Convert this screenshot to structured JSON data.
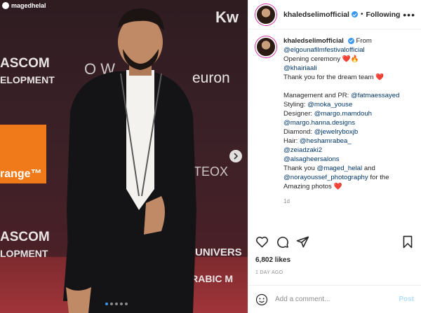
{
  "watermark": {
    "text": "magedhelal"
  },
  "sponsors": {
    "kw": "Kw",
    "ascom_top": "ASCOM",
    "dev_top": "ELOPMENT",
    "ow": "O W",
    "euron": "euron",
    "orange": "range™",
    "teox": "TEOX",
    "ascom_bottom": "ASCOM",
    "dev_bottom": "LOPMENT",
    "universal": "UNIVERS",
    "arabic": "ARABIC M"
  },
  "carousel": {
    "count": 5,
    "active_index": 1
  },
  "header": {
    "username": "khaledselimofficial",
    "separator": "•",
    "follow_label": "Following",
    "more_label": "•••"
  },
  "caption": {
    "username": "khaledselimofficial",
    "lines": [
      {
        "text": "From"
      },
      {
        "link": "@elgounafilmfestivalofficial"
      },
      {
        "text": "Opening ceremony ❤️🔥"
      },
      {
        "link": "@khairiaali"
      },
      {
        "text": "Thank you for the dream team ❤️"
      },
      {
        "gap": true
      },
      {
        "text": "Management and PR: ",
        "link": "@fatmaessayed"
      },
      {
        "text": "Styling: ",
        "link": "@moka_youse"
      },
      {
        "text": "Designer: ",
        "link": "@margo.mamdouh"
      },
      {
        "link": "@margo.hanna.designs"
      },
      {
        "text": "Diamond: ",
        "link": "@jewelryboxjb"
      },
      {
        "text": "Hair: ",
        "link": "@heshamrabea_"
      },
      {
        "link": "@zeiadzaki2"
      },
      {
        "link": "@alsagheersalons"
      },
      {
        "text": "Thank you ",
        "link": "@maged_helal",
        "after": " and"
      },
      {
        "link": "@norayoussef_photography",
        "after": " for the"
      },
      {
        "text": "Amazing photos ❤️"
      }
    ],
    "timestamp": "1d"
  },
  "likes": "6,802 likes",
  "date": "1 DAY AGO",
  "comment": {
    "placeholder": "Add a comment...",
    "post_label": "Post"
  },
  "icons": [
    "heart-icon",
    "comment-icon",
    "share-icon",
    "bookmark-icon",
    "emoji-icon",
    "chevron-right-icon",
    "verified-icon"
  ]
}
